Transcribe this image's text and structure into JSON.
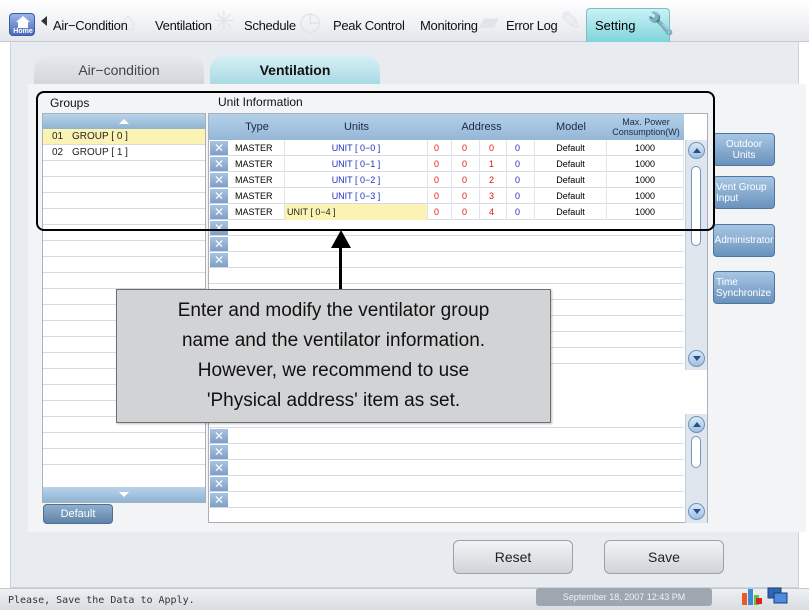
{
  "nav": {
    "home": "Home",
    "items": [
      "Air−Condition",
      "Ventilation",
      "Schedule",
      "Peak Control",
      "Monitoring",
      "Error Log"
    ],
    "active": "Setting"
  },
  "subtabs": {
    "air": "Air−condition",
    "vent": "Ventilation"
  },
  "groups": {
    "label": "Groups",
    "rows": [
      {
        "num": "01",
        "name": "GROUP [ 0 ]",
        "selected": true
      },
      {
        "num": "02",
        "name": "GROUP [ 1 ]",
        "selected": false
      }
    ],
    "default_label": "Default"
  },
  "unit_info": {
    "label": "Unit Information",
    "headers": {
      "type": "Type",
      "units": "Units",
      "address": "Address",
      "model": "Model",
      "max_power_1": "Max. Power",
      "max_power_2": "Consumption(W)"
    },
    "rows": [
      {
        "type": "MASTER",
        "units": "UNIT [ 0−0 ]",
        "a1": "0",
        "a2": "0",
        "a3": "0",
        "a4": "0",
        "model": "Default",
        "power": "1000"
      },
      {
        "type": "MASTER",
        "units": "UNIT [ 0−1 ]",
        "a1": "0",
        "a2": "0",
        "a3": "1",
        "a4": "0",
        "model": "Default",
        "power": "1000"
      },
      {
        "type": "MASTER",
        "units": "UNIT [ 0−2 ]",
        "a1": "0",
        "a2": "0",
        "a3": "2",
        "a4": "0",
        "model": "Default",
        "power": "1000"
      },
      {
        "type": "MASTER",
        "units": "UNIT [ 0−3 ]",
        "a1": "0",
        "a2": "0",
        "a3": "3",
        "a4": "0",
        "model": "Default",
        "power": "1000"
      },
      {
        "type": "MASTER",
        "units": "UNIT [ 0−4 ]",
        "a1": "0",
        "a2": "0",
        "a3": "4",
        "a4": "0",
        "model": "Default",
        "power": "1000"
      }
    ],
    "x_glyph": "✕"
  },
  "side_buttons": {
    "outdoor_1": "Outdoor",
    "outdoor_2": "Units",
    "vent_1": "Vent Group",
    "vent_2": "Input",
    "admin": "Administrator",
    "time_1": "Time",
    "time_2": "Synchronize"
  },
  "actions": {
    "reset": "Reset",
    "save": "Save"
  },
  "status": {
    "message": "Please, Save the Data to Apply.",
    "datetime": "September 18, 2007 12:43 PM"
  },
  "callout": {
    "lines": [
      "Enter and modify the ventilator group",
      "name and the ventilator information.",
      "However, we recommend to use",
      "'Physical address' item as set."
    ]
  },
  "colors": {
    "accent": "#7fd5dc",
    "selected_row": "#fbf3b4",
    "address_red": "#d11111",
    "units_blue": "#1e2fbf"
  },
  "icons": [
    "home-icon",
    "back-arrow-icon",
    "wrench-icon",
    "x-delete-icon",
    "scroll-up-icon",
    "scroll-down-icon",
    "network-icon"
  ]
}
